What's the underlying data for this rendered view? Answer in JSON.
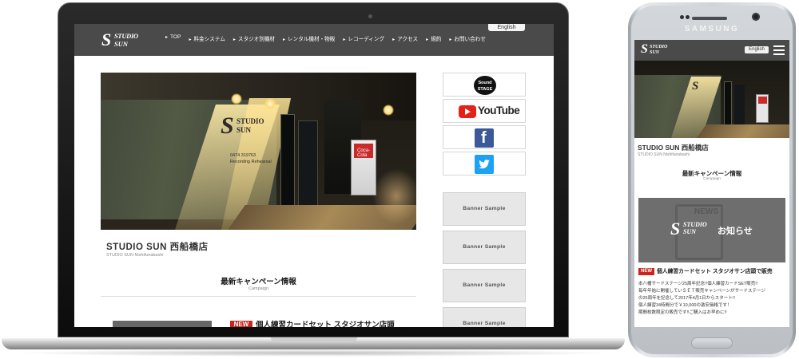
{
  "site": {
    "lang_button": "English",
    "logo": {
      "mark": "S",
      "line1": "STUDIO",
      "line2": "SUN"
    },
    "nav": [
      "TOP",
      "料金システム",
      "スタジオ別機材",
      "レンタル機材・物販",
      "レコーディング",
      "アクセス",
      "規約",
      "お問い合わせ"
    ],
    "hero_sign": {
      "mark": "S",
      "line1": "STUDIO",
      "line2": "SUN",
      "phone": "0474 319763",
      "tagline": "Recording Rehearsal"
    },
    "vending_brand": "Coca-Cola",
    "store_name": "STUDIO SUN 西船橋店",
    "store_sub": "STUDIO SUN Nishifunabashi",
    "section_title": "最新キャンペーン情報",
    "section_sub": "Campaign",
    "news_badge": "NEW",
    "news_title": "個人練習カードセット スタジオサン店頭",
    "sidebar": {
      "sound_stage": "Sound STAGE",
      "youtube": "YouTube",
      "facebook": "f",
      "twitter_icon": "twitter-bird",
      "banners": [
        "Banner Sample",
        "Banner Sample",
        "Banner Sample",
        "Banner Sample"
      ]
    }
  },
  "phone": {
    "brand": "SAMSUNG",
    "lang_button": "English",
    "logo": {
      "mark": "S",
      "line1": "STUDIO",
      "line2": "SUN"
    },
    "store_name": "STUDIO SUN 西船橋店",
    "store_sub": "STUDIO SUN Nishifunabashi",
    "section_title": "最新キャンペーン情報",
    "section_sub": "Campaign",
    "news_image": {
      "word": "NEWS",
      "mark": "S",
      "line1": "STUDIO",
      "line2": "SUN",
      "text": "お知らせ"
    },
    "news_badge": "NEW",
    "news_headline": "個人練習カードセット スタジオサン店頭で販売",
    "news_body": [
      "本八幡サードステージ25周年記念!!個人練習カードSET販売!!",
      "毎年年始に開催していＳＥＴ販売キャンペーンがサードステージ",
      "の25周年を記念して2017年4月1日からスタート!!",
      "個人練習34時間分で￥10,000の激安価格です！",
      "期間枚数限定の販売です!!ご購入はお早めに!!"
    ]
  },
  "colors": {
    "header": "#4a4a4a",
    "badge": "#c9241d",
    "youtube": "#e62117",
    "facebook": "#3b5998",
    "twitter": "#1da1f2"
  }
}
